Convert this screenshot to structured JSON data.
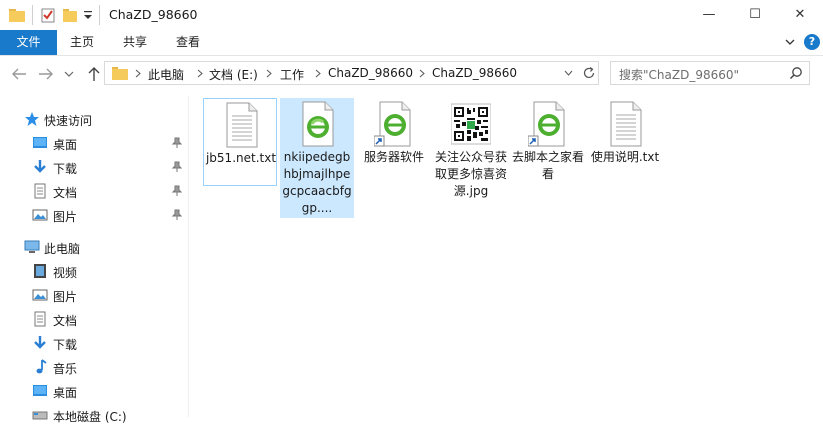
{
  "window": {
    "title": "ChaZD_98660",
    "controls": {
      "minimize": "—",
      "maximize": "☐",
      "close": "✕"
    }
  },
  "ribbon": {
    "file_tab": "文件",
    "tabs": [
      "主页",
      "共享",
      "查看"
    ],
    "help": "?"
  },
  "address": {
    "crumbs": [
      "此电脑",
      "文档 (E:)",
      "工作",
      "ChaZD_98660",
      "ChaZD_98660"
    ]
  },
  "search": {
    "placeholder": "搜索\"ChaZD_98660\""
  },
  "sidebar": {
    "quick_access": "快速访问",
    "quick_items": [
      "桌面",
      "下载",
      "文档",
      "图片"
    ],
    "this_pc": "此电脑",
    "pc_items": [
      "视频",
      "图片",
      "文档",
      "下载",
      "音乐",
      "桌面",
      "本地磁盘 (C:)"
    ]
  },
  "files": [
    {
      "name": "jb51.net.txt",
      "icon": "text-file-icon"
    },
    {
      "name": "nkiipedegbhbjmajlhpegcpcaacbfggp....",
      "icon": "chrome-extension-icon"
    },
    {
      "name": "服务器软件",
      "icon": "shortcut-icon"
    },
    {
      "name": "关注公众号获取更多惊喜资源.jpg",
      "icon": "qr-image-icon"
    },
    {
      "name": "去脚本之家看看",
      "icon": "shortcut-icon"
    },
    {
      "name": "使用说明.txt",
      "icon": "text-file-icon"
    }
  ],
  "colors": {
    "accent": "#1979ca",
    "selection": "#cce8ff",
    "focus_border": "#99d1ff"
  }
}
